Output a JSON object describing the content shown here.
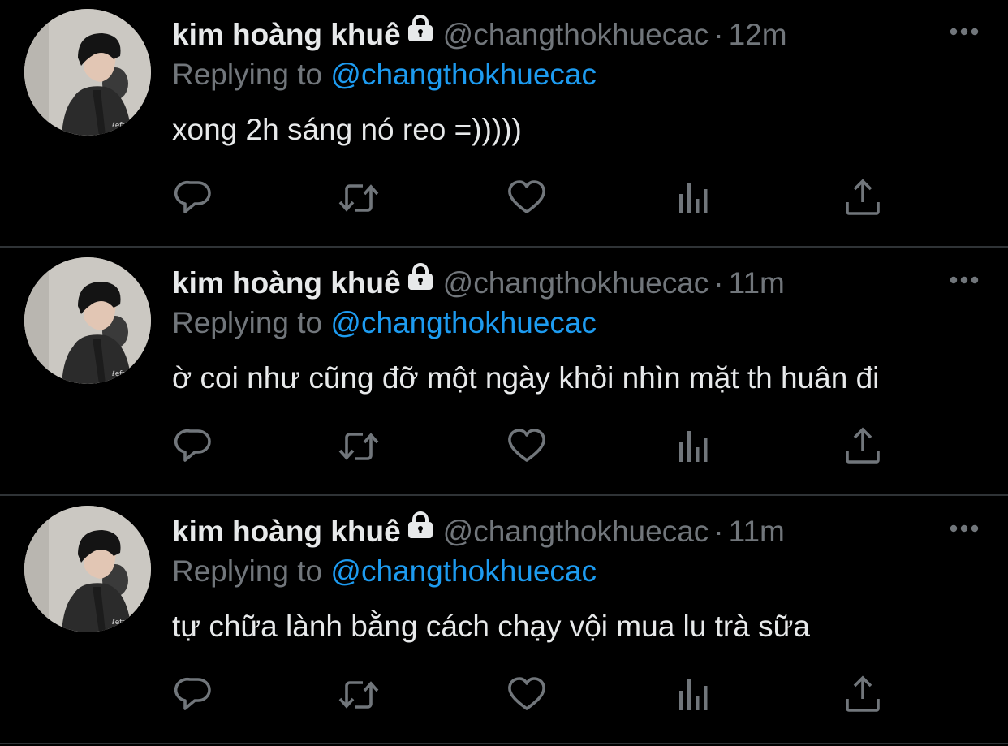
{
  "colors": {
    "background": "#000000",
    "muted": "#71767b",
    "link": "#1d9bf0",
    "text": "#e7e9ea",
    "divider": "#2f3336"
  },
  "tweets": [
    {
      "display_name": "kim hoàng khuê",
      "handle": "@changthokhuecac",
      "separator": "·",
      "time": "12m",
      "replying_label": "Replying to",
      "replying_to": "@changthokhuecac",
      "text": "xong 2h sáng nó reo =)))))",
      "icons": [
        "lock-icon",
        "more-icon",
        "reply-icon",
        "retweet-icon",
        "like-icon",
        "analytics-icon",
        "share-icon"
      ]
    },
    {
      "display_name": "kim hoàng khuê",
      "handle": "@changthokhuecac",
      "separator": "·",
      "time": "11m",
      "replying_label": "Replying to",
      "replying_to": "@changthokhuecac",
      "text": "ờ coi như cũng đỡ một ngày khỏi nhìn mặt th huân đi",
      "icons": [
        "lock-icon",
        "more-icon",
        "reply-icon",
        "retweet-icon",
        "like-icon",
        "analytics-icon",
        "share-icon"
      ]
    },
    {
      "display_name": "kim hoàng khuê",
      "handle": "@changthokhuecac",
      "separator": "·",
      "time": "11m",
      "replying_label": "Replying to",
      "replying_to": "@changthokhuecac",
      "text": "tự chữa lành bằng cách chạy vội mua lu trà sữa",
      "icons": [
        "lock-icon",
        "more-icon",
        "reply-icon",
        "retweet-icon",
        "like-icon",
        "analytics-icon",
        "share-icon"
      ]
    }
  ]
}
